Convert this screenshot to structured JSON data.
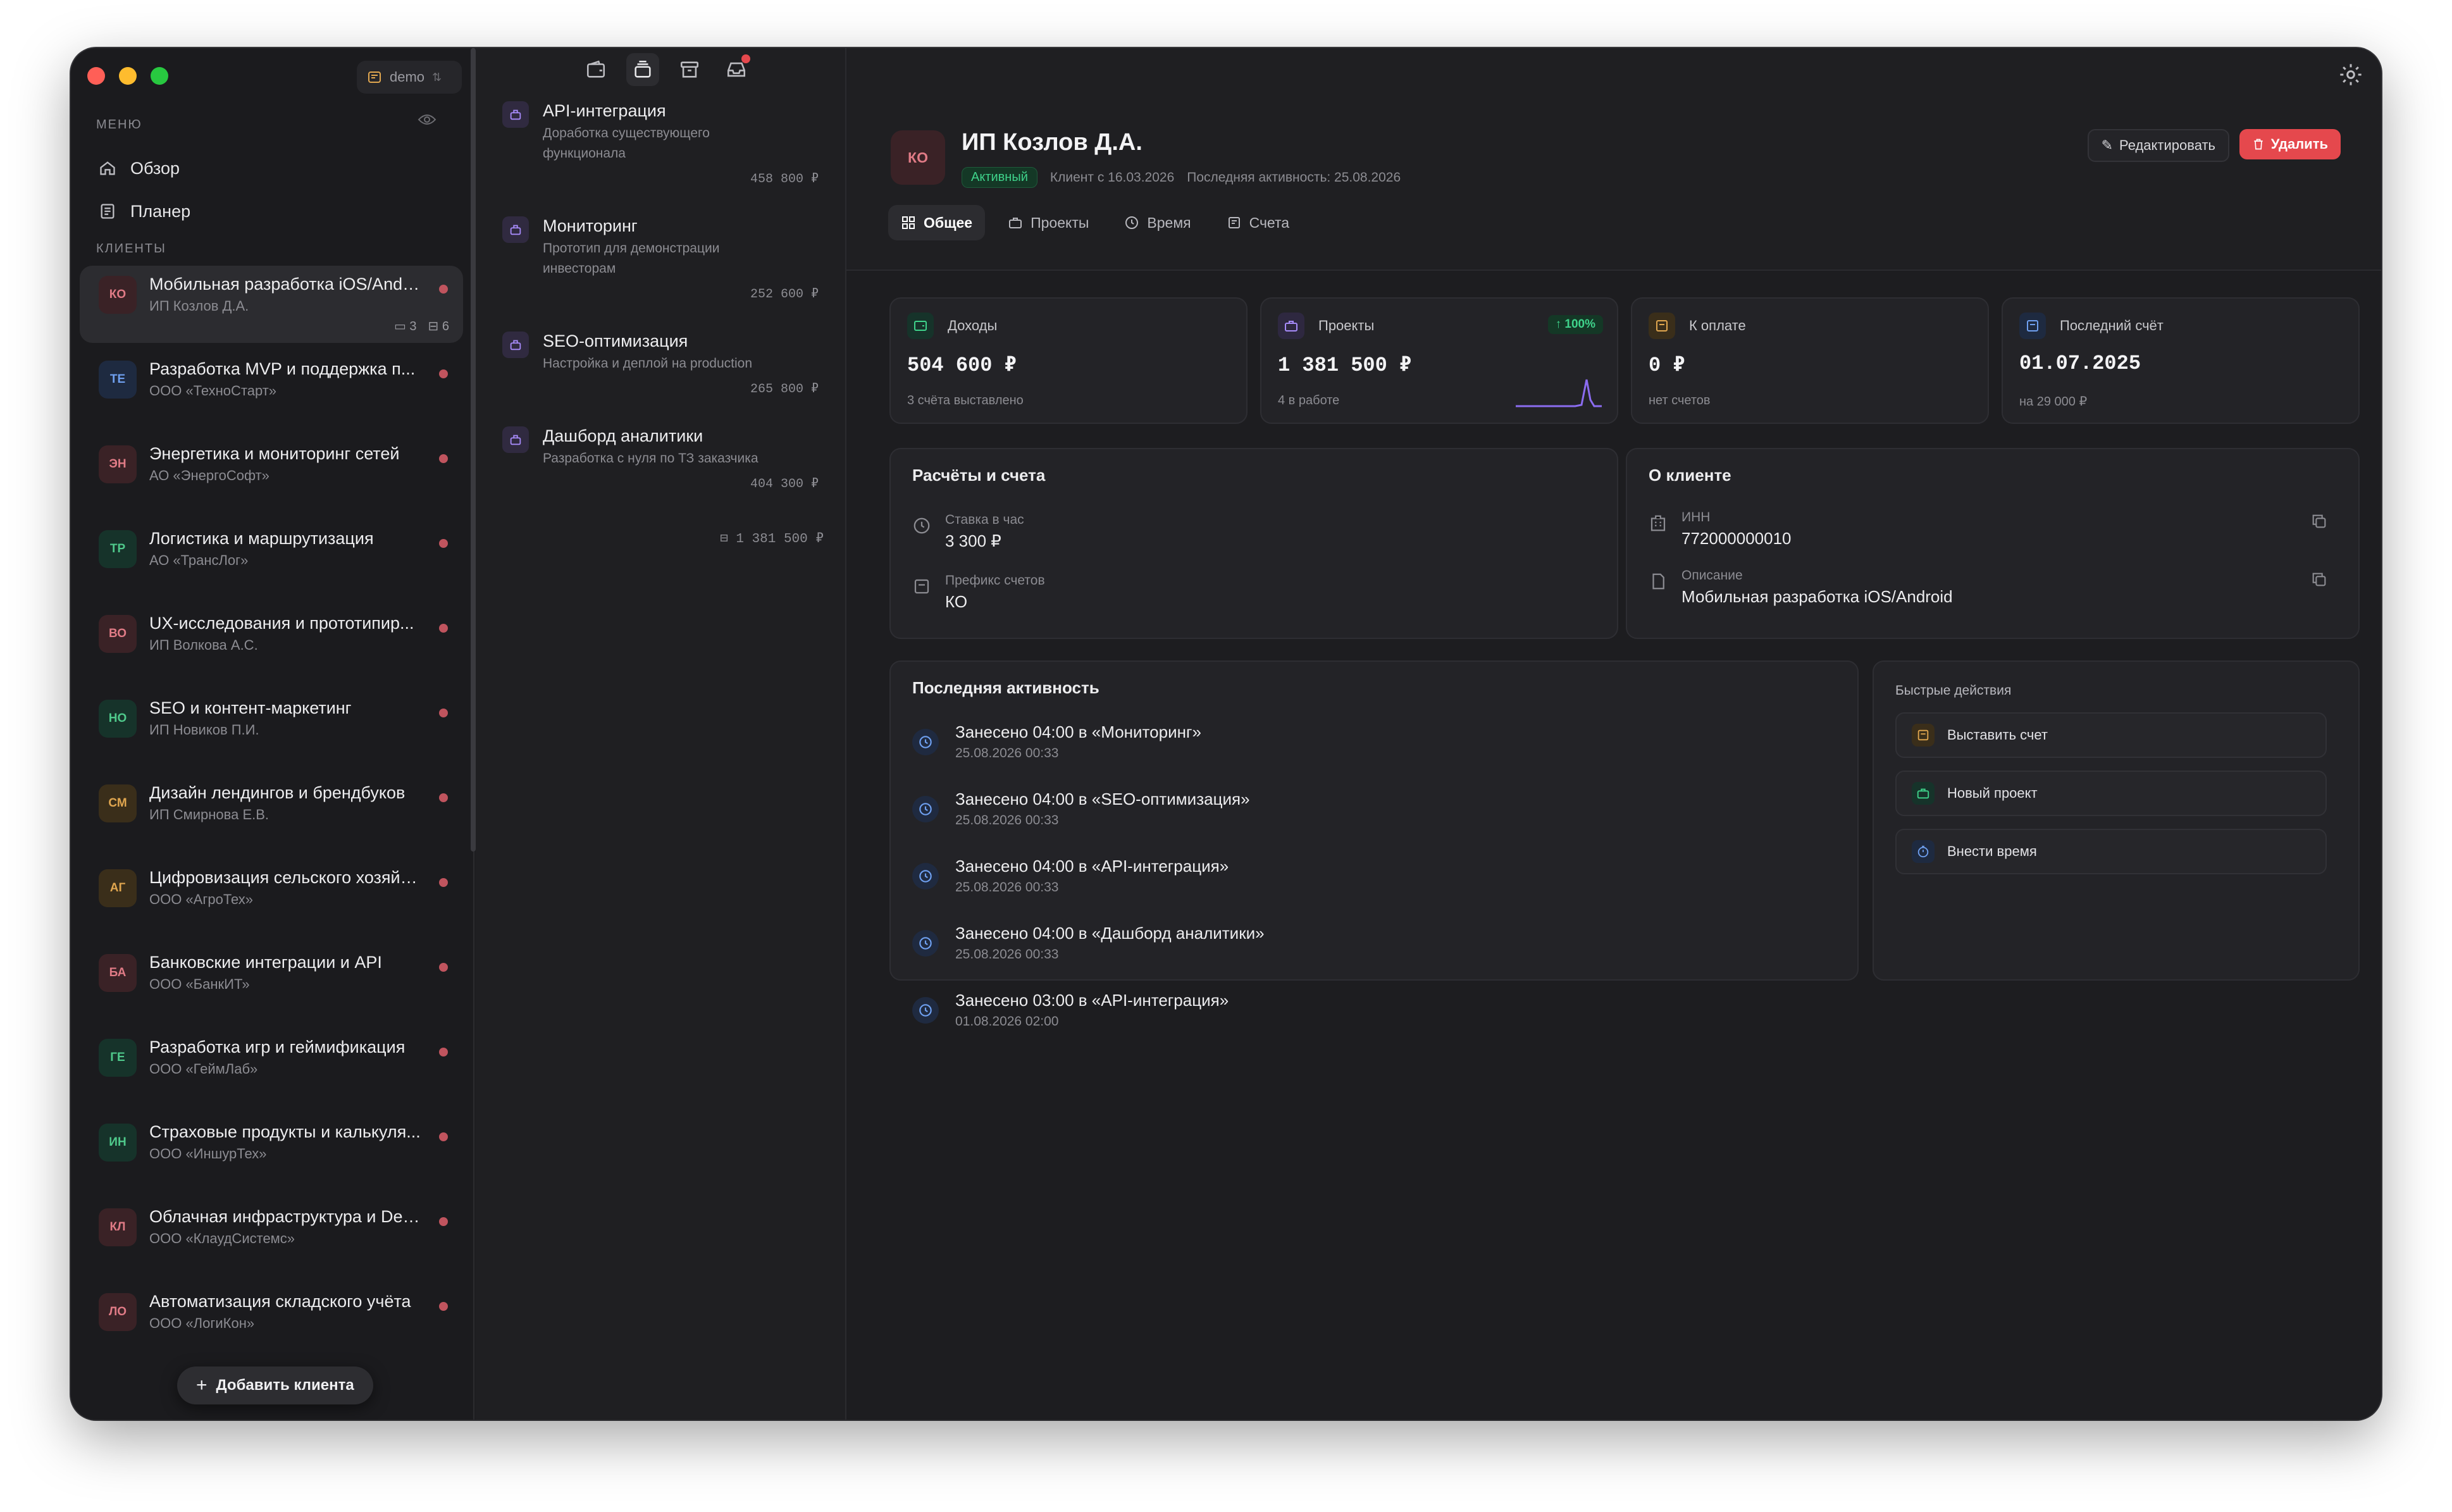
{
  "workspace": {
    "name": "demo"
  },
  "sidebar": {
    "menu_label": "МЕНЮ",
    "nav": [
      {
        "label": "Обзор",
        "icon": "home-icon"
      },
      {
        "label": "Планер",
        "icon": "planner-icon"
      }
    ],
    "clients_label": "КЛИЕНТЫ",
    "clients": [
      {
        "initials": "КО",
        "name": "Мобильная разработка iOS/Andr...",
        "company": "ИП Козлов Д.А.",
        "active": true,
        "invoices": "3",
        "projects": "6",
        "bg": "#3a2226",
        "fg": "#e07b86"
      },
      {
        "initials": "ТЕ",
        "name": "Разработка MVP и поддержка п...",
        "company": "ООО «ТехноСтарт»",
        "bg": "#1e2a40",
        "fg": "#6fa0f0"
      },
      {
        "initials": "ЭН",
        "name": "Энергетика и мониторинг сетей",
        "company": "АО «ЭнергоСофт»",
        "bg": "#3a2226",
        "fg": "#e07b86"
      },
      {
        "initials": "ТР",
        "name": "Логистика и маршрутизация",
        "company": "АО «ТрансЛог»",
        "bg": "#16332a",
        "fg": "#4fc98b"
      },
      {
        "initials": "ВО",
        "name": "UX-исследования и прототипир...",
        "company": "ИП Волкова А.С.",
        "bg": "#3a2226",
        "fg": "#e07b86"
      },
      {
        "initials": "НО",
        "name": "SEO и контент-маркетинг",
        "company": "ИП Новиков П.И.",
        "bg": "#16332a",
        "fg": "#4fc98b"
      },
      {
        "initials": "СМ",
        "name": "Дизайн лендингов и брендбуков",
        "company": "ИП Смирнова Е.В.",
        "bg": "#3a2e1a",
        "fg": "#e0a64f"
      },
      {
        "initials": "АГ",
        "name": "Цифровизация сельского хозяйс...",
        "company": "ООО «АгроТех»",
        "bg": "#3a2e1a",
        "fg": "#e0a64f"
      },
      {
        "initials": "БА",
        "name": "Банковские интеграции и API",
        "company": "ООО «БанкИТ»",
        "bg": "#3a2226",
        "fg": "#e07b86"
      },
      {
        "initials": "ГЕ",
        "name": "Разработка игр и геймификация",
        "company": "ООО «ГеймЛаб»",
        "bg": "#16332a",
        "fg": "#4fc98b"
      },
      {
        "initials": "ИН",
        "name": "Страховые продукты и калькуля...",
        "company": "ООО «ИншурТех»",
        "bg": "#16332a",
        "fg": "#4fc98b"
      },
      {
        "initials": "КЛ",
        "name": "Облачная инфраструктура и Dev...",
        "company": "ООО «КлаудСистемс»",
        "bg": "#3a2226",
        "fg": "#e07b86"
      },
      {
        "initials": "ЛО",
        "name": "Автоматизация складского учёта",
        "company": "ООО «ЛогиКон»",
        "bg": "#3a2226",
        "fg": "#e07b86"
      }
    ],
    "add_client_label": "Добавить клиента"
  },
  "projects": {
    "items": [
      {
        "title": "API-интеграция",
        "desc": "Доработка существующего функционала",
        "amount": "458 800 ₽"
      },
      {
        "title": "Мониторинг",
        "desc": "Прототип для демонстрации инвесторам",
        "amount": "252 600 ₽"
      },
      {
        "title": "SEO-оптимизация",
        "desc": "Настройка и деплой на production",
        "amount": "265 800 ₽"
      },
      {
        "title": "Дашборд аналитики",
        "desc": "Разработка с нуля по ТЗ заказчика",
        "amount": "404 300 ₽"
      }
    ],
    "total": "1 381 500 ₽"
  },
  "client": {
    "initials": "КО",
    "name": "ИП Козлов Д.А.",
    "status": "Активный",
    "since": "Клиент с 16.03.2026",
    "last_activity": "Последняя активность: 25.08.2026",
    "edit_label": "Редактировать",
    "delete_label": "Удалить"
  },
  "tabs": [
    {
      "label": "Общее",
      "active": true
    },
    {
      "label": "Проекты"
    },
    {
      "label": "Время"
    },
    {
      "label": "Счета"
    }
  ],
  "stats": [
    {
      "label": "Доходы",
      "value": "504 600 ₽",
      "note": "3 счёта выставлено",
      "color": "#3fd38b"
    },
    {
      "label": "Проекты",
      "value": "1 381 500 ₽",
      "note": "4 в работе",
      "trend": "↑ 100%",
      "color": "#a78bfa"
    },
    {
      "label": "К оплате",
      "value": "0 ₽",
      "note": "нет счетов",
      "color": "#e0a64f"
    },
    {
      "label": "Последний счёт",
      "value": "01.07.2025",
      "note": "на 29 000 ₽",
      "color": "#6fa0f0"
    }
  ],
  "billing": {
    "title": "Расчёты и счета",
    "rate_label": "Ставка в час",
    "rate_value": "3 300 ₽",
    "prefix_label": "Префикс счетов",
    "prefix_value": "КО"
  },
  "about": {
    "title": "О клиенте",
    "inn_label": "ИНН",
    "inn_value": "772000000010",
    "desc_label": "Описание",
    "desc_value": "Мобильная разработка iOS/Android"
  },
  "activity": {
    "title": "Последняя активность",
    "items": [
      {
        "text": "Занесено 04:00 в «Мониторинг»",
        "date": "25.08.2026 00:33"
      },
      {
        "text": "Занесено 04:00 в «SEO-оптимизация»",
        "date": "25.08.2026 00:33"
      },
      {
        "text": "Занесено 04:00 в «API-интеграция»",
        "date": "25.08.2026 00:33"
      },
      {
        "text": "Занесено 04:00 в «Дашборд аналитики»",
        "date": "25.08.2026 00:33"
      },
      {
        "text": "Занесено 03:00 в «API-интеграция»",
        "date": "01.08.2026 02:00"
      }
    ]
  },
  "quick_actions": {
    "title": "Быстрые действия",
    "items": [
      {
        "label": "Выставить счет",
        "color": "#e0a64f"
      },
      {
        "label": "Новый проект",
        "color": "#3fd38b"
      },
      {
        "label": "Внести время",
        "color": "#6fa0f0"
      }
    ]
  }
}
